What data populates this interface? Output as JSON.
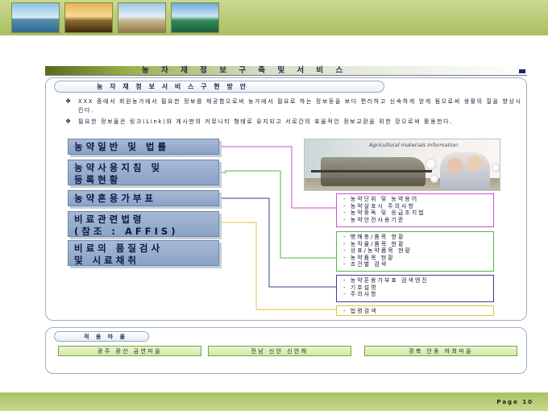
{
  "title": "농 자 재  정 보  구 축  및  서 비 스",
  "section_heading": "농 자 재  정 보  서 비 스  구 현  방 안",
  "bullets": [
    "XXX 중에서 회원농가에서 필요한 정보를 제공함으로써 농가에서 필요로 하는 정보등을 보다 편리하고 신속하게 얻게 됨으로써 생활의 질을 향상시킨다.",
    "필요한 정보들은 링크(Link)와 게시판의 커뮤니티 형태로 유지되고 서로간의 효율적인 정보교환을 위한 장으로써 활용한다."
  ],
  "categories": [
    {
      "lines": [
        "농약일반 및 법률"
      ]
    },
    {
      "lines": [
        "농약사용지침 및",
        "등록현황"
      ]
    },
    {
      "lines": [
        "농약혼용가부표"
      ]
    },
    {
      "lines": [
        "비료관련법령",
        "(참조 : AFFIS)"
      ]
    },
    {
      "lines": [
        "비료의 품질검사",
        "및 시료채취"
      ]
    }
  ],
  "image_caption": "Agricultural materials Information",
  "details": [
    [
      "- 농약단위 및 농약용어",
      "- 농약살포시 주의사항",
      "- 농약중독 및 응급조치법",
      "- 농약안전사용기준"
    ],
    [
      "- 병해충/품목 현황",
      "- 농작물/품목 현황",
      "- 상표/농약품목 현황",
      "- 농약품목 현황",
      "- 조건별 검색"
    ],
    [
      "- 농약혼용가부표 검색엔진",
      "- 기호설명",
      "- 주의사항"
    ],
    [
      "- 법령검색"
    ]
  ],
  "villages": {
    "heading": "적 용 마 을",
    "items": [
      "광주 광산 금연마을",
      "전남 신안 신안해",
      "경북 안동 하회마을"
    ]
  },
  "page_label": "Page 10",
  "colors": {
    "band_green": "#a9bf62",
    "category_blue": "#8aa2c6",
    "connector_magenta": "#d24fd2",
    "connector_green": "#53b443",
    "connector_navy": "#3c3f8a",
    "connector_yellow": "#e0c23a"
  }
}
